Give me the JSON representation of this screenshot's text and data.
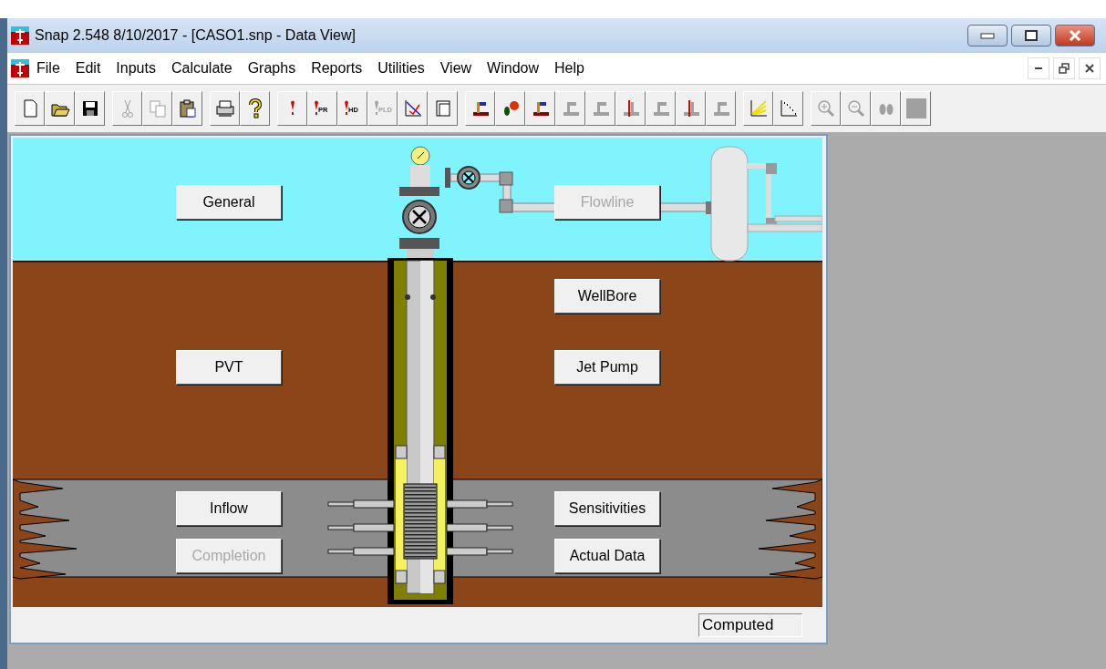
{
  "window": {
    "title": "Snap 2.548 8/10/2017 - [CASO1.snp - Data View]"
  },
  "menu": [
    {
      "label": "File"
    },
    {
      "label": "Edit"
    },
    {
      "label": "Inputs"
    },
    {
      "label": "Calculate"
    },
    {
      "label": "Graphs"
    },
    {
      "label": "Reports"
    },
    {
      "label": "Utilities"
    },
    {
      "label": "View"
    },
    {
      "label": "Window"
    },
    {
      "label": "Help"
    }
  ],
  "toolbar": [
    [
      {
        "kind": "new",
        "disabled": false
      },
      {
        "kind": "open",
        "disabled": false
      },
      {
        "kind": "save",
        "disabled": false
      }
    ],
    [
      {
        "kind": "cut",
        "disabled": true
      },
      {
        "kind": "copy",
        "disabled": true
      },
      {
        "kind": "paste",
        "disabled": false
      }
    ],
    [
      {
        "kind": "print",
        "disabled": false
      },
      {
        "kind": "help",
        "disabled": false
      }
    ],
    [
      {
        "kind": "marker",
        "disabled": false
      },
      {
        "kind": "marker",
        "label": "PR",
        "disabled": false
      },
      {
        "kind": "marker",
        "label": "HD",
        "disabled": false
      },
      {
        "kind": "marker",
        "label": "PLD",
        "disabled": true
      },
      {
        "kind": "plot",
        "disabled": false
      },
      {
        "kind": "page",
        "disabled": false
      }
    ],
    [
      {
        "kind": "well",
        "disabled": false
      },
      {
        "kind": "drops",
        "disabled": false
      },
      {
        "kind": "well",
        "disabled": false
      },
      {
        "kind": "well",
        "disabled": true
      },
      {
        "kind": "well",
        "disabled": true
      },
      {
        "kind": "well-line",
        "disabled": false
      },
      {
        "kind": "well",
        "disabled": true
      },
      {
        "kind": "well-line",
        "disabled": false
      },
      {
        "kind": "well",
        "disabled": true
      }
    ],
    [
      {
        "kind": "curves",
        "disabled": false
      },
      {
        "kind": "dots",
        "disabled": false
      }
    ],
    [
      {
        "kind": "zoom-in",
        "disabled": true
      },
      {
        "kind": "zoom-out",
        "disabled": true
      },
      {
        "kind": "binoculars",
        "disabled": true
      },
      {
        "kind": "square",
        "disabled": true
      }
    ]
  ],
  "diagram": {
    "buttons": [
      {
        "label": "General",
        "disabled": false
      },
      {
        "label": "Flowline",
        "disabled": true
      },
      {
        "label": "WellBore",
        "disabled": false
      },
      {
        "label": "PVT",
        "disabled": false
      },
      {
        "label": "Jet Pump",
        "disabled": false
      },
      {
        "label": "Inflow",
        "disabled": false
      },
      {
        "label": "Sensitivities",
        "disabled": false
      },
      {
        "label": "Completion",
        "disabled": true
      },
      {
        "label": "Actual Data",
        "disabled": false
      }
    ]
  },
  "status_bar": {
    "status": "Computed"
  }
}
